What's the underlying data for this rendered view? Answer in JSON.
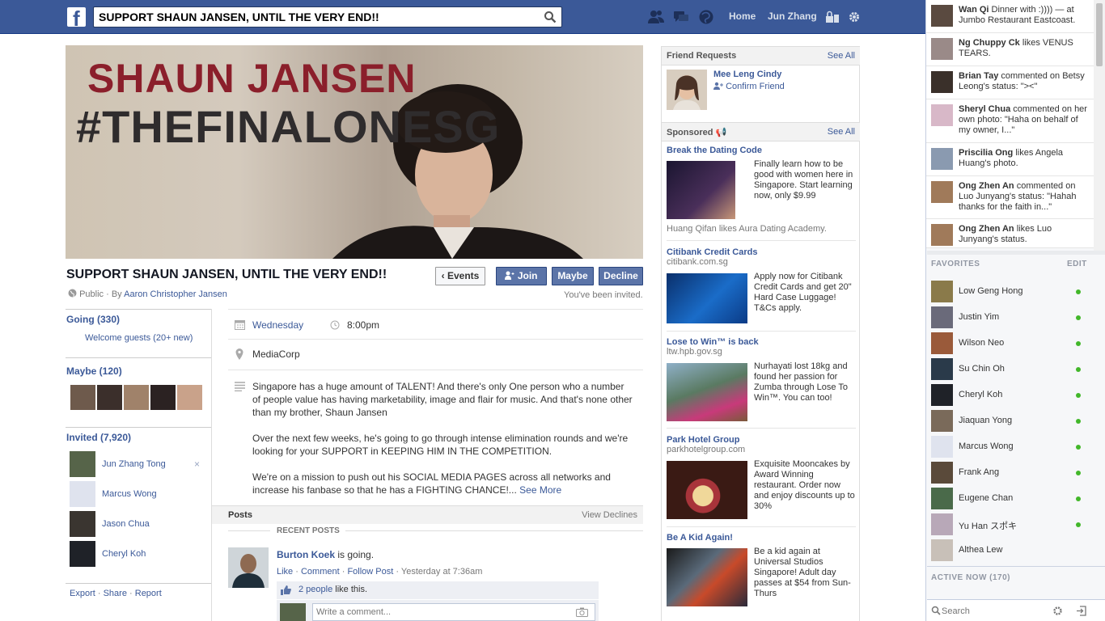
{
  "topbar": {
    "search_value": "SUPPORT SHAUN JANSEN, UNTIL THE VERY END!!",
    "nav": [
      "Home",
      "Jun Zhang"
    ],
    "icons": [
      "friend-requests-icon",
      "messages-icon",
      "notifications-icon",
      "privacy-lock-icon",
      "settings-gear-icon"
    ],
    "brand_color": "#3b5998"
  },
  "cover": {
    "line1": "SHAUN JANSEN",
    "line2": "#THEFINALONESG"
  },
  "event": {
    "title": "SUPPORT SHAUN JANSEN, UNTIL THE VERY END!!",
    "privacy": "Public",
    "by_prefix": "· By",
    "host": "Aaron Christopher Jansen",
    "buttons": {
      "events": "Events",
      "join": "Join",
      "maybe": "Maybe",
      "decline": "Decline"
    },
    "invited_note": "You've been invited.",
    "day": "Wednesday",
    "time": "8:00pm",
    "location": "MediaCorp",
    "description": [
      "Singapore has a huge amount of TALENT! And there's only One person who a number of people value has having marketability, image and flair for music. And that's none other than my brother, Shaun Jansen",
      "Over the next few weeks, he's going to go through intense elimination rounds and we're looking for your SUPPORT in KEEPING HIM IN THE COMPETITION.",
      "We're on a mission to push out his SOCIAL MEDIA PAGES across all networks and increase his fanbase so that he has a FIGHTING CHANCE!..."
    ],
    "see_more": "See More"
  },
  "left": {
    "going": "Going (330)",
    "welcome": "Welcome guests (20+ new)",
    "maybe": "Maybe (120)",
    "invited": "Invited (7,920)",
    "invited_people": [
      "Jun Zhang Tong",
      "Marcus Wong",
      "Jason Chua",
      "Cheryl Koh"
    ],
    "remove_symbol": "×",
    "footer": {
      "export": "Export",
      "share": "Share",
      "report": "Report",
      "sep": "·"
    }
  },
  "posts": {
    "header": "Posts",
    "view_declines": "View Declines",
    "recent": "RECENT POSTS",
    "author": "Burton Koek",
    "status": "is going.",
    "actions": [
      "Like",
      "Comment",
      "Follow Post"
    ],
    "time": "Yesterday at 7:36am",
    "likes_link": "2 people",
    "likes_rest": "like this.",
    "comment_placeholder": "Write a comment..."
  },
  "friend_requests": {
    "header": "Friend Requests",
    "see_all": "See All",
    "name": "Mee Leng Cindy",
    "confirm": "Confirm Friend"
  },
  "sponsored": {
    "header": "Sponsored",
    "see_all": "See All",
    "ads": [
      {
        "title": "Break the Dating Code",
        "domain": "",
        "text": "Finally learn how to be good with women here in Singapore. Start learning now, only $9.99",
        "social": "Huang Qifan likes Aura Dating Academy."
      },
      {
        "title": "Citibank Credit Cards",
        "domain": "citibank.com.sg",
        "text": "Apply now for Citibank Credit Cards and get 20\" Hard Case Luggage! T&Cs apply.",
        "social": ""
      },
      {
        "title": "Lose to Win™ is back",
        "domain": "ltw.hpb.gov.sg",
        "text": "Nurhayati lost 18kg and found her passion for Zumba through Lose To Win™. You can too!",
        "social": ""
      },
      {
        "title": "Park Hotel Group",
        "domain": "parkhotelgroup.com",
        "text": "Exquisite Mooncakes by Award Winning restaurant. Order now and enjoy discounts up to 30%",
        "social": ""
      },
      {
        "title": "Be A Kid Again!",
        "domain": "",
        "text": "Be a kid again at Universal Studios Singapore! Adult day passes at $54 from Sun-Thurs",
        "social": ""
      }
    ]
  },
  "ticker": [
    {
      "name": "Wan Qi",
      "text": "Dinner with :)))) — at Jumbo Restaurant Eastcoast."
    },
    {
      "name": "Ng Chuppy Ck",
      "text": "likes VENUS TEARS."
    },
    {
      "name": "Brian Tay",
      "text": "commented on Betsy Leong's status: \"><\""
    },
    {
      "name": "Sheryl Chua",
      "text": "commented on her own photo: \"Haha on behalf of my owner, I...\""
    },
    {
      "name": "Priscilia Ong",
      "text": "likes Angela Huang's photo."
    },
    {
      "name": "Ong Zhen An",
      "text": "commented on Luo Junyang's status: \"Hahah thanks for the faith in...\""
    },
    {
      "name": "Ong Zhen An",
      "text": "likes Luo Junyang's status."
    }
  ],
  "favorites": {
    "header": "FAVORITES",
    "edit": "EDIT",
    "people": [
      "Low Geng Hong",
      "Justin Yim",
      "Wilson Neo",
      "Su Chin Oh",
      "Cheryl Koh",
      "Jiaquan Yong",
      "Marcus Wong",
      "Frank Ang",
      "Eugene Chan",
      "Yu Han スポキ",
      "Althea Lew"
    ],
    "online_color": "#42b72a"
  },
  "active_now": "ACTIVE NOW (170)",
  "chat_search_placeholder": "Search"
}
